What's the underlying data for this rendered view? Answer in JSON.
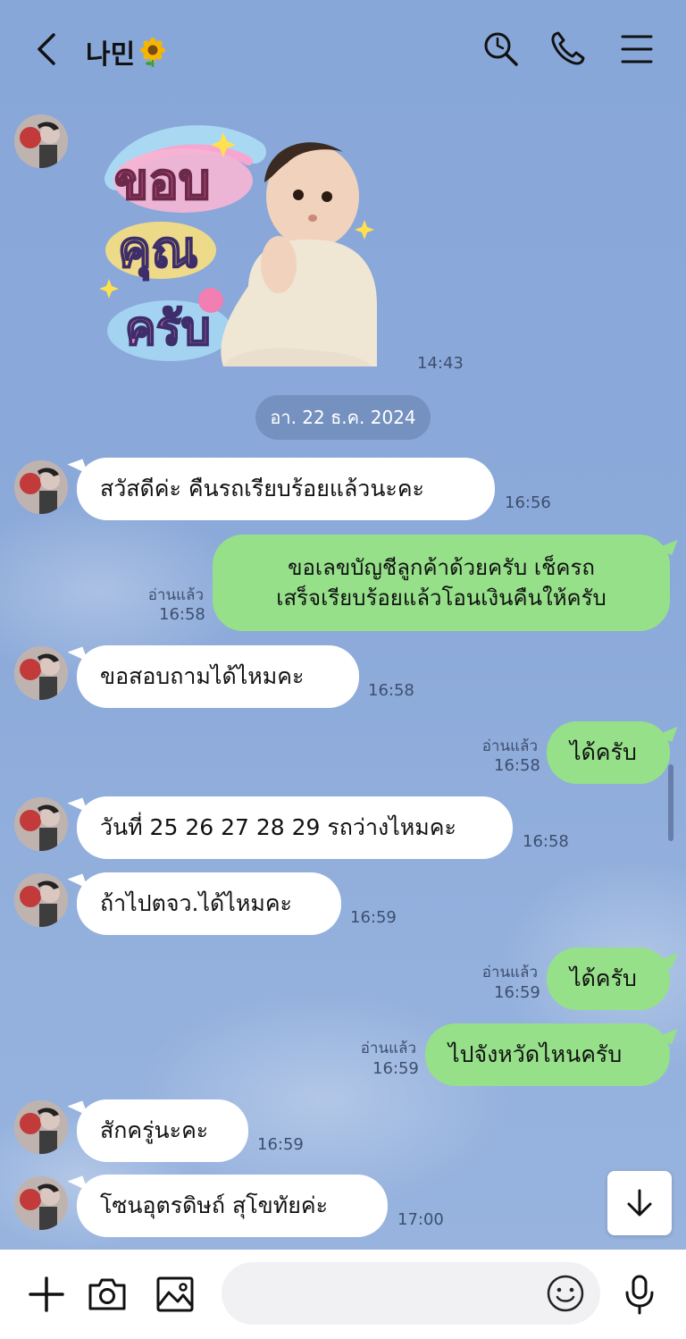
{
  "header": {
    "contact_name": "나민",
    "title_emoji": "🌻"
  },
  "sticker": {
    "time": "14:43"
  },
  "date_separator": "อา. 22 ธ.ค. 2024",
  "messages": [
    {
      "dir": "in",
      "text": "สวัสดีค่ะ คืนรถเรียบร้อยแล้วนะคะ",
      "time": "16:56"
    },
    {
      "dir": "out",
      "line1": "ขอเลขบัญชีลูกค้าด้วยครับ เช็ครถ",
      "line2": "เสร็จเรียบร้อยแล้วโอนเงินคืนให้ครับ",
      "read": "อ่านแล้ว",
      "time": "16:58"
    },
    {
      "dir": "in",
      "text": "ขอสอบถามได้ไหมคะ",
      "time": "16:58"
    },
    {
      "dir": "out",
      "text": "ได้ครับ",
      "read": "อ่านแล้ว",
      "time": "16:58"
    },
    {
      "dir": "in",
      "text": "วันที่ 25 26 27 28 29 รถว่างไหมคะ",
      "time": "16:58"
    },
    {
      "dir": "in",
      "text": "ถ้าไปตจว.ได้ไหมคะ",
      "time": "16:59"
    },
    {
      "dir": "out",
      "text": "ได้ครับ",
      "read": "อ่านแล้ว",
      "time": "16:59"
    },
    {
      "dir": "out",
      "text": "ไปจังหวัดไหนครับ",
      "read": "อ่านแล้ว",
      "time": "16:59"
    },
    {
      "dir": "in",
      "text": "สักครู่นะคะ",
      "time": "16:59"
    },
    {
      "dir": "in",
      "text": "โซนอุตรดิษถ์ สุโขทัยค่ะ",
      "time": "17:00"
    }
  ],
  "input": {
    "placeholder": ""
  },
  "colors": {
    "background": "#8aa8d8",
    "outgoing_bubble": "#96e08a",
    "incoming_bubble": "#ffffff"
  }
}
